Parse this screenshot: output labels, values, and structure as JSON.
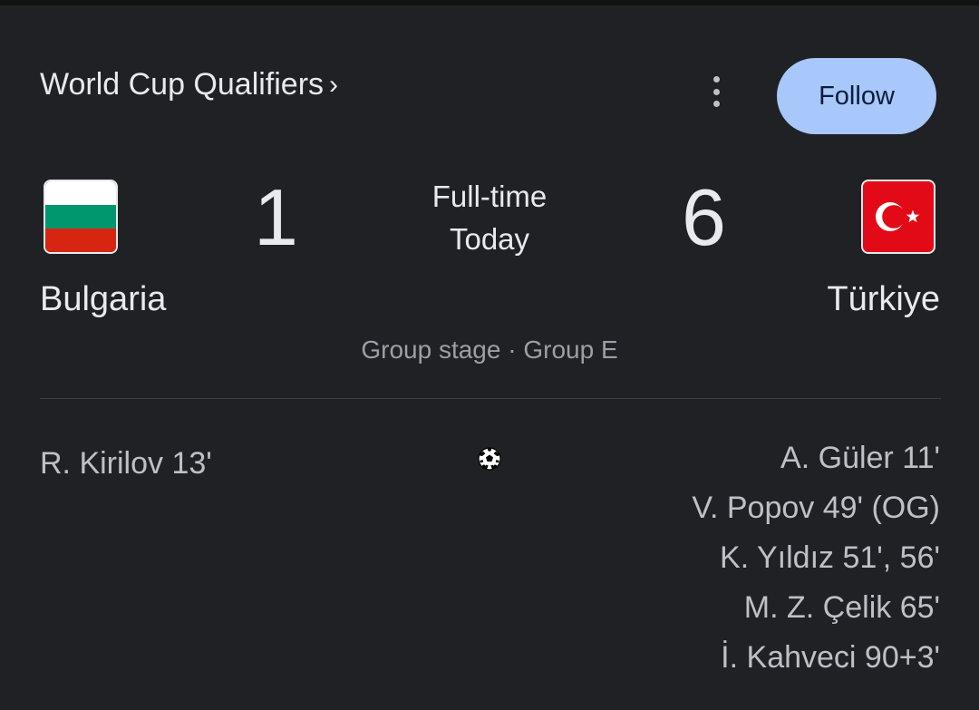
{
  "header": {
    "competition": "World Cup Qualifiers",
    "chevron": "›",
    "more_icon": "more-vert-icon",
    "follow_label": "Follow"
  },
  "colors": {
    "background": "#202124",
    "follow_button": "#a8c7fa",
    "bulgaria_flag": [
      "#ffffff",
      "#00966e",
      "#d62612"
    ],
    "turkiye_flag": "#e30a17"
  },
  "match": {
    "home_team": "Bulgaria",
    "away_team": "Türkiye",
    "home_score": "1",
    "away_score": "6",
    "status": "Full-time",
    "date": "Today",
    "stage": "Group stage · Group E"
  },
  "goals": {
    "icon": "soccer-ball-icon",
    "home": [
      "R. Kirilov 13'"
    ],
    "away": [
      "A. Güler 11'",
      "V. Popov 49' (OG)",
      "K. Yıldız 51', 56'",
      "M. Z. Çelik 65'",
      "İ. Kahveci 90+3'"
    ]
  }
}
